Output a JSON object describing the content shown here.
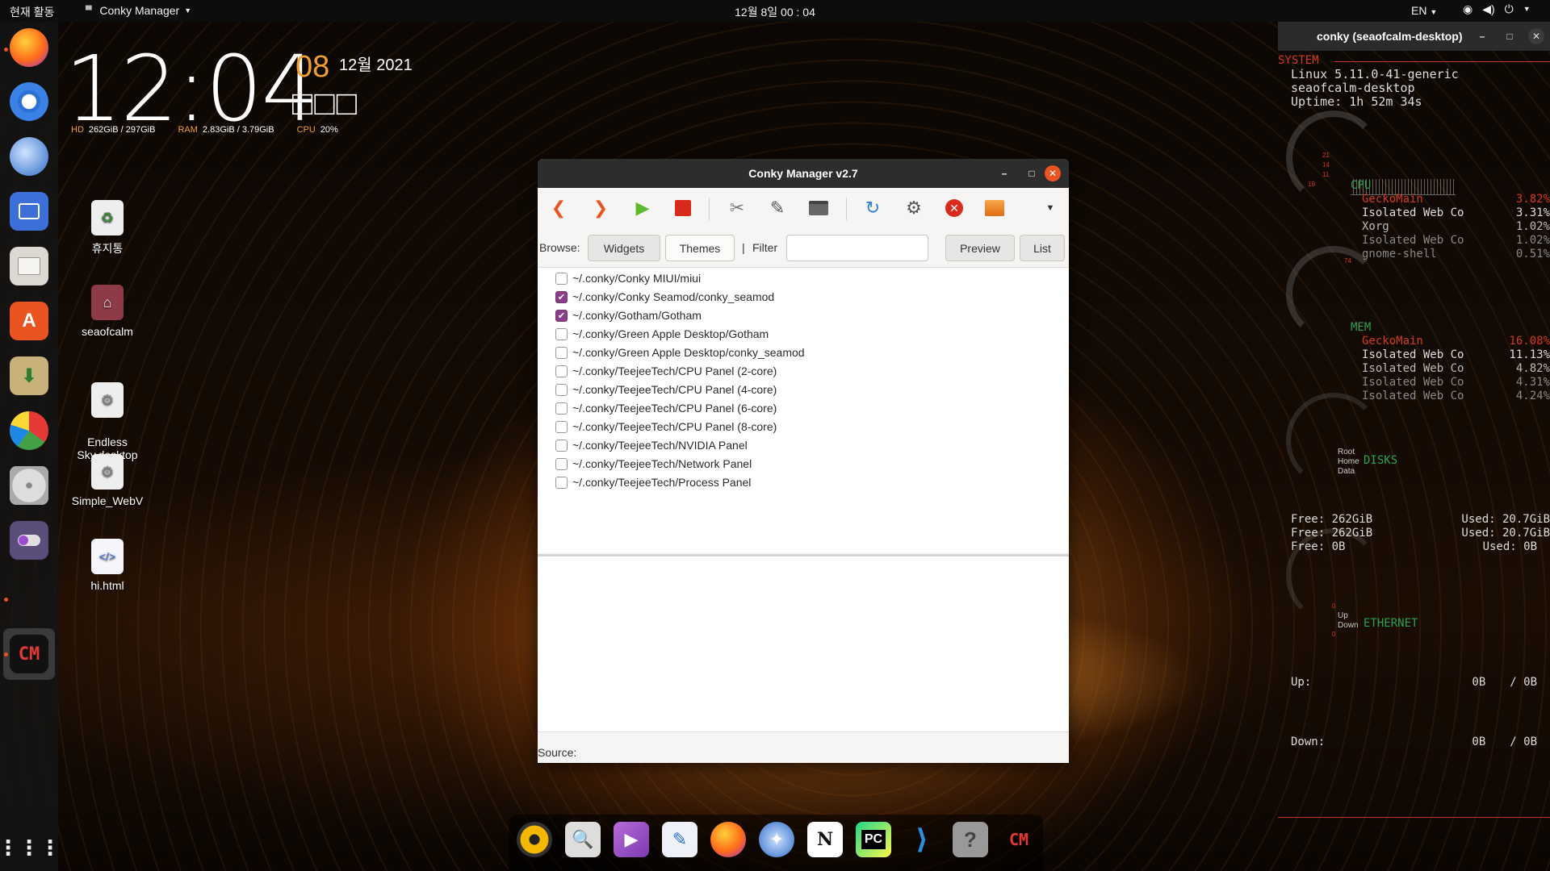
{
  "topbar": {
    "activities": "현재 활동",
    "app_name": "Conky Manager",
    "clock": "12월 8일  00 : 04",
    "lang": "EN",
    "icons": [
      "wifi-icon",
      "volume-icon",
      "power-icon",
      "chevron-down-icon"
    ]
  },
  "desktop": {
    "icons": [
      {
        "label": "휴지통",
        "icon": "trash-icon"
      },
      {
        "label": "seaofcalm",
        "icon": "home-folder-icon"
      },
      {
        "label": "Endless\nSky.desktop",
        "icon": "gear-icon"
      },
      {
        "label": "Simple_WebV",
        "icon": "gear-icon"
      },
      {
        "label": "hi.html",
        "icon": "html-file-icon"
      }
    ]
  },
  "clock_widget": {
    "time": "12:04",
    "seconds": "08",
    "date": "12월 2021",
    "weekday": "□□□",
    "hd_label": "HD",
    "hd_value": "262GiB / 297GiB",
    "ram_label": "RAM",
    "ram_value": "2.83GiB / 3.79GiB",
    "cpu_label": "CPU",
    "cpu_value": "20%"
  },
  "conky_window": {
    "title": "conky (seaofcalm-desktop)",
    "system_header": "SYSTEM",
    "kernel": "Linux 5.11.0-41-generic",
    "host": "seaofcalm-desktop",
    "uptime": "Uptime: 1h 52m 34s",
    "cpu_header": "CPU",
    "cpu_procs": [
      {
        "name": "GeckoMain",
        "value": "3.82%"
      },
      {
        "name": "Isolated Web Co",
        "value": "3.31%"
      },
      {
        "name": "Xorg",
        "value": "1.02%"
      },
      {
        "name": "Isolated Web Co",
        "value": "1.02%"
      },
      {
        "name": "gnome-shell",
        "value": "0.51%"
      }
    ],
    "mem_header": "MEM",
    "mem_procs": [
      {
        "name": "GeckoMain",
        "value": "16.08%"
      },
      {
        "name": "Isolated Web Co",
        "value": "11.13%"
      },
      {
        "name": "Isolated Web Co",
        "value": "4.82%"
      },
      {
        "name": "Isolated Web Co",
        "value": "4.31%"
      },
      {
        "name": "Isolated Web Co",
        "value": "4.24%"
      }
    ],
    "disks_header": "DISKS",
    "disk_labels": [
      "Root",
      "Home",
      "Data"
    ],
    "disks": [
      {
        "free": "Free: 262GiB",
        "used": "Used: 20.7GiB"
      },
      {
        "free": "Free: 262GiB",
        "used": "Used: 20.7GiB"
      },
      {
        "free": "Free: 0B",
        "used": "Used: 0B"
      }
    ],
    "ethernet_header": "ETHERNET",
    "net_labels": [
      "Up",
      "Down"
    ],
    "up_label": "Up:",
    "up_value": "0B",
    "up_total": "/ 0B",
    "down_label": "Down:",
    "down_value": "0B",
    "down_total": "/ 0B",
    "gauge_ticks": [
      "21",
      "14",
      "11",
      "19",
      "74",
      "0",
      "0"
    ]
  },
  "manager": {
    "title": "Conky Manager v2.7",
    "browse_label": "Browse:",
    "widgets_btn": "Widgets",
    "themes_btn": "Themes",
    "separator": "|",
    "filter_label": "Filter",
    "filter_value": "",
    "preview_btn": "Preview",
    "list_btn": "List",
    "source_label": "Source:",
    "items": [
      {
        "path": "~/.conky/Conky MIUI/miui",
        "checked": false
      },
      {
        "path": "~/.conky/Conky Seamod/conky_seamod",
        "checked": true
      },
      {
        "path": "~/.conky/Gotham/Gotham",
        "checked": true
      },
      {
        "path": "~/.conky/Green Apple Desktop/Gotham",
        "checked": false
      },
      {
        "path": "~/.conky/Green Apple Desktop/conky_seamod",
        "checked": false
      },
      {
        "path": "~/.conky/TeejeeTech/CPU Panel (2-core)",
        "checked": false
      },
      {
        "path": "~/.conky/TeejeeTech/CPU Panel (4-core)",
        "checked": false
      },
      {
        "path": "~/.conky/TeejeeTech/CPU Panel (6-core)",
        "checked": false
      },
      {
        "path": "~/.conky/TeejeeTech/CPU Panel (8-core)",
        "checked": false
      },
      {
        "path": "~/.conky/TeejeeTech/NVIDIA Panel",
        "checked": false
      },
      {
        "path": "~/.conky/TeejeeTech/Network Panel",
        "checked": false
      },
      {
        "path": "~/.conky/TeejeeTech/Process Panel",
        "checked": false
      }
    ]
  },
  "dock": {
    "apps": [
      "firefox-icon",
      "chromium-icon",
      "thunderbird-icon",
      "workspaces-icon",
      "files-icon",
      "software-center-icon",
      "archive-manager-icon",
      "disk-usage-icon",
      "disk-icon",
      "settings-toggle-icon",
      "conky-manager-icon"
    ],
    "show_apps_icon": "app-grid-icon"
  },
  "taskbar": {
    "apps": [
      "rhythmbox-icon",
      "image-viewer-icon",
      "video-player-icon",
      "text-editor-icon",
      "firefox-icon",
      "web-browser-icon",
      "notion-icon",
      "pycharm-icon",
      "vscode-icon",
      "help-icon",
      "conky-manager-icon"
    ],
    "notion_letter": "N",
    "pycharm_text": "PC",
    "help_text": "?",
    "cm_text": "CM"
  },
  "colors": {
    "accent": "#e95420",
    "checkbox": "#8a3e86",
    "conky_orange": "#f0a030",
    "conky_red": "#d33a1a",
    "conky_green": "#2da050"
  }
}
